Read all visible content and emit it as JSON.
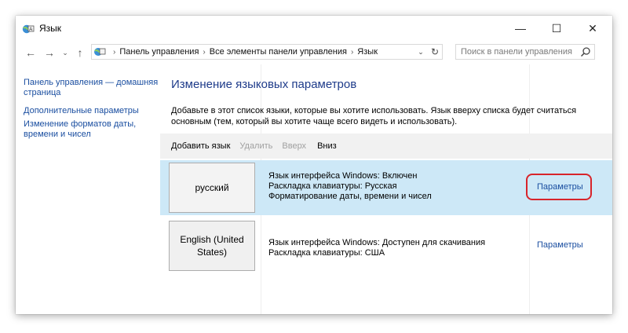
{
  "window": {
    "title": "Язык",
    "controls": {
      "minimize": "—",
      "maximize": "☐",
      "close": "✕"
    }
  },
  "nav": {
    "back": "←",
    "forward": "→",
    "recent": "⌄",
    "up": "↑"
  },
  "address": {
    "crumbs": [
      "Панель управления",
      "Все элементы панели управления",
      "Язык"
    ],
    "dropdown": "⌄",
    "refresh": "↻"
  },
  "search": {
    "placeholder": "Поиск в панели управления"
  },
  "sidebar": {
    "items": [
      {
        "label": "Панель управления — домашняя страница"
      },
      {
        "label": "Дополнительные параметры"
      },
      {
        "label": "Изменение форматов даты, времени и чисел"
      }
    ]
  },
  "main": {
    "heading": "Изменение языковых параметров",
    "description": "Добавьте в этот список языки, которые вы хотите использовать. Язык вверху списка будет считаться основным (тем, который вы хотите чаще всего видеть и использовать).",
    "toolbar": {
      "add": "Добавить язык",
      "remove": "Удалить",
      "up": "Вверх",
      "down": "Вниз"
    },
    "languages": [
      {
        "name": "русский",
        "info": [
          "Язык интерфейса Windows: Включен",
          "Раскладка клавиатуры: Русская",
          "Форматирование даты, времени и чисел"
        ],
        "options_label": "Параметры"
      },
      {
        "name": "English (United States)",
        "info": [
          "Язык интерфейса Windows: Доступен для скачивания",
          "Раскладка клавиатуры: США"
        ],
        "options_label": "Параметры"
      }
    ]
  },
  "colors": {
    "link": "#1a4ea0",
    "heading": "#1e3b8a",
    "selected_row": "#cde8f7",
    "toolbar_bg": "#f1f1f1",
    "highlight": "#d8242a"
  }
}
